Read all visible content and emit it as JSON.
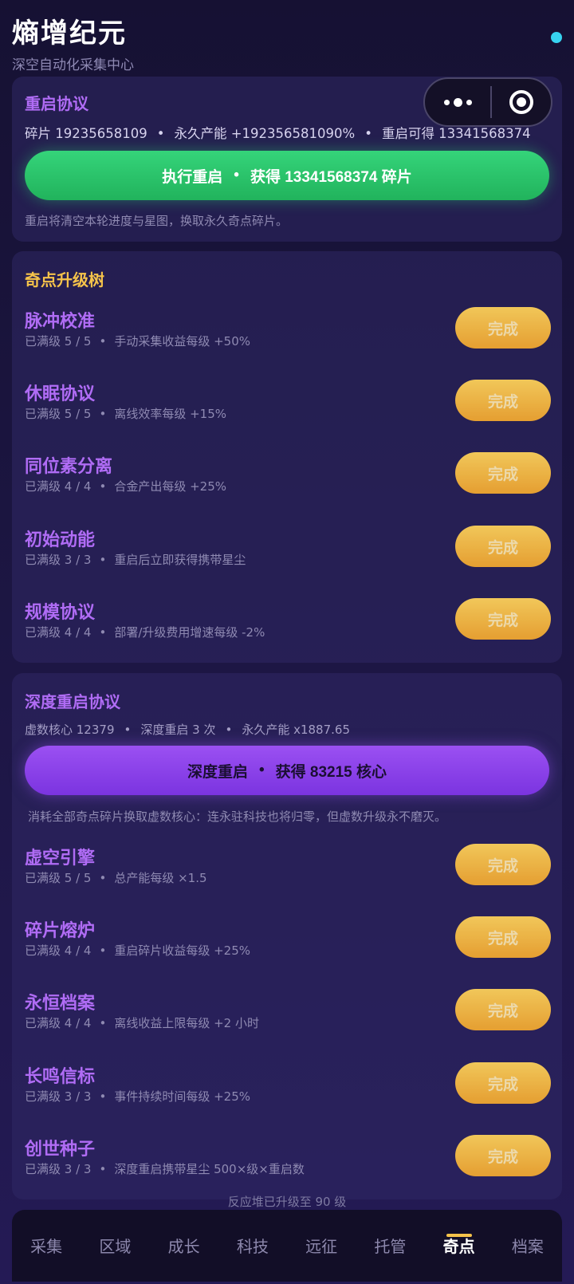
{
  "app": {
    "title": "熵增纪元",
    "subtitle": "深空自动化采集中心"
  },
  "restart": {
    "title": "重启协议",
    "fragments": "碎片 19235658109",
    "permanent": "永久产能 +192356581090%",
    "gain": "重启可得 13341568374",
    "button_action": "执行重启",
    "button_gain": "获得 13341568374 碎片",
    "note": "重启将清空本轮进度与星图，换取永久奇点碎片。"
  },
  "tree": {
    "title": "奇点升级树",
    "items": [
      {
        "name": "脉冲校准",
        "level": "已满级 5 / 5",
        "effect": "手动采集收益每级 +50%",
        "button": "完成"
      },
      {
        "name": "休眠协议",
        "level": "已满级 5 / 5",
        "effect": "离线效率每级 +15%",
        "button": "完成"
      },
      {
        "name": "同位素分离",
        "level": "已满级 4 / 4",
        "effect": "合金产出每级 +25%",
        "button": "完成"
      },
      {
        "name": "初始动能",
        "level": "已满级 3 / 3",
        "effect": "重启后立即获得携带星尘",
        "button": "完成"
      },
      {
        "name": "规模协议",
        "level": "已满级 4 / 4",
        "effect": "部署/升级费用增速每级 -2%",
        "button": "完成"
      }
    ]
  },
  "deep": {
    "title": "深度重启协议",
    "cores": "虚数核心 12379",
    "count": "深度重启 3 次",
    "permanent": "永久产能 x1887.65",
    "button_action": "深度重启",
    "button_gain": "获得 83215 核心",
    "note": "消耗全部奇点碎片换取虚数核心：连永驻科技也将归零，但虚数升级永不磨灭。",
    "items": [
      {
        "name": "虚空引擎",
        "level": "已满级 5 / 5",
        "effect": "总产能每级 ×1.5",
        "button": "完成"
      },
      {
        "name": "碎片熔炉",
        "level": "已满级 4 / 4",
        "effect": "重启碎片收益每级 +25%",
        "button": "完成"
      },
      {
        "name": "永恒档案",
        "level": "已满级 4 / 4",
        "effect": "离线收益上限每级 +2 小时",
        "button": "完成"
      },
      {
        "name": "长鸣信标",
        "level": "已满级 3 / 3",
        "effect": "事件持续时间每级 +25%",
        "button": "完成"
      },
      {
        "name": "创世种子",
        "level": "已满级 3 / 3",
        "effect": "深度重启携带星尘 500×级×重启数",
        "button": "完成"
      }
    ]
  },
  "reactor": "反应堆已升级至 90 级",
  "tabs": [
    "采集",
    "区域",
    "成长",
    "科技",
    "远征",
    "托管",
    "奇点",
    "档案"
  ],
  "active_tab": "奇点",
  "separator": "•"
}
